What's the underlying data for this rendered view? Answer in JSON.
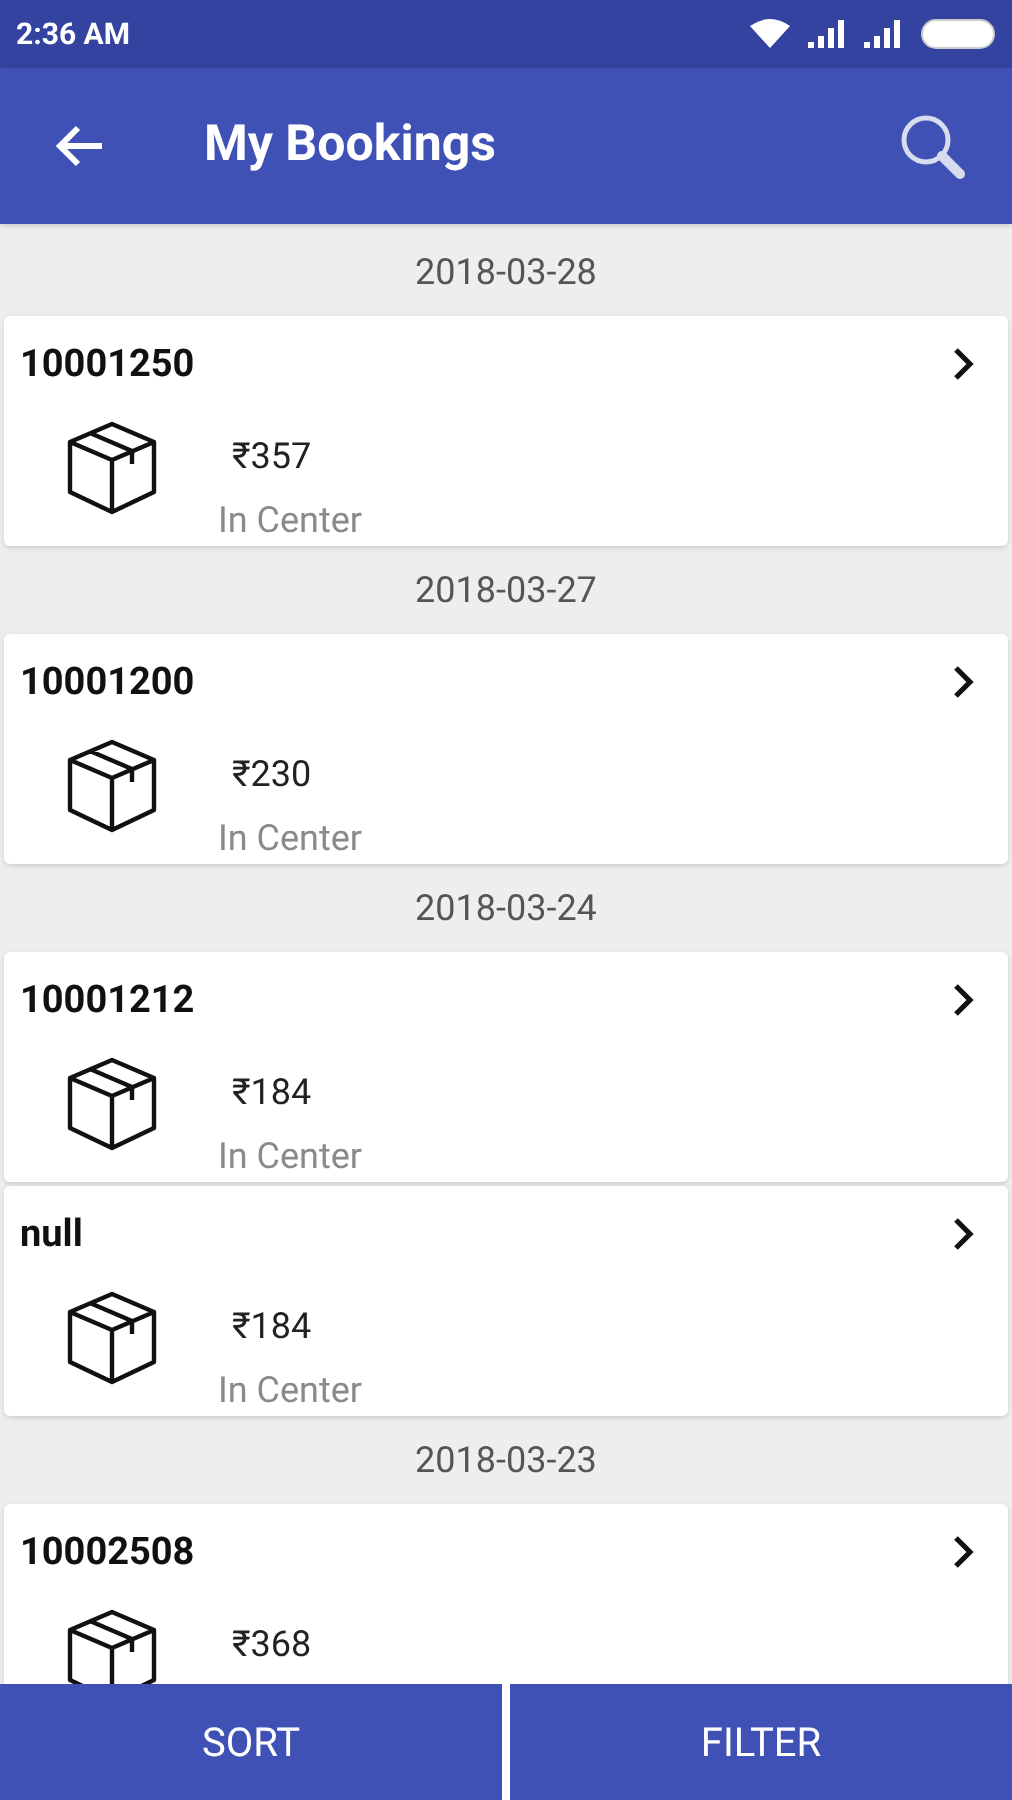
{
  "status_bar": {
    "time": "2:36 AM"
  },
  "app_bar": {
    "title": "My Bookings"
  },
  "groups": [
    {
      "date": "2018-03-28",
      "bookings": [
        {
          "id": "10001250",
          "price": "₹357",
          "status": "In Center"
        }
      ]
    },
    {
      "date": "2018-03-27",
      "bookings": [
        {
          "id": "10001200",
          "price": "₹230",
          "status": "In Center"
        }
      ]
    },
    {
      "date": "2018-03-24",
      "bookings": [
        {
          "id": "10001212",
          "price": "₹184",
          "status": "In Center"
        },
        {
          "id": "null",
          "price": "₹184",
          "status": "In Center"
        }
      ]
    },
    {
      "date": "2018-03-23",
      "bookings": [
        {
          "id": "10002508",
          "price": "₹368"
        }
      ]
    }
  ],
  "bottom_bar": [
    "SORT",
    "FILTER"
  ]
}
